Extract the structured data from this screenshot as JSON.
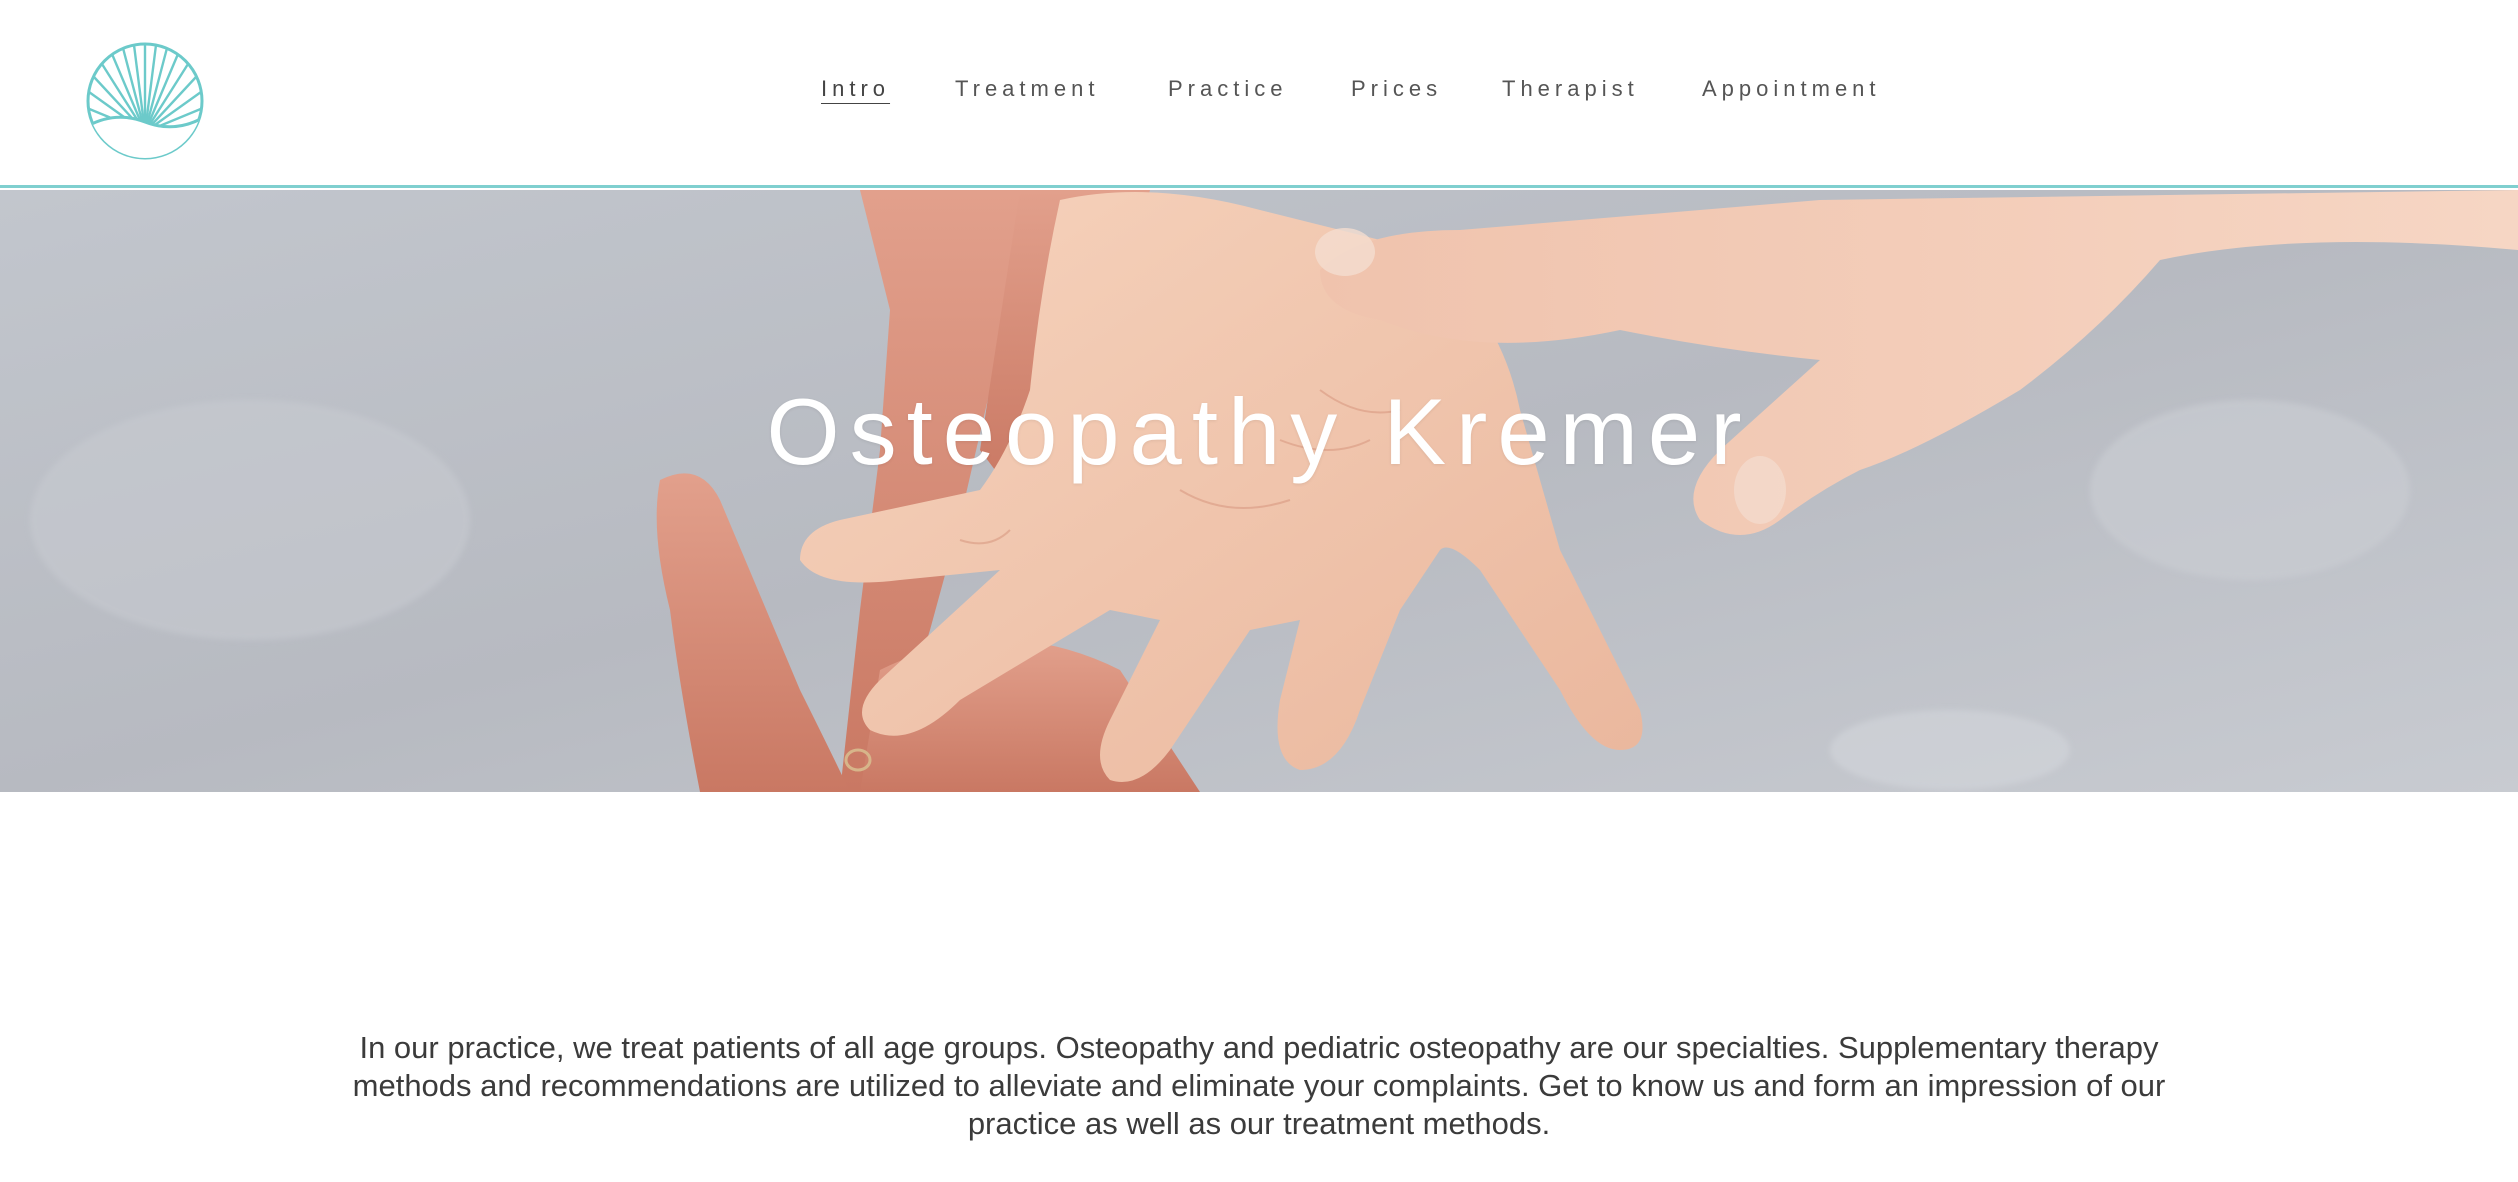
{
  "header": {
    "logo_icon": "sunrise-shell-logo-icon",
    "accent_color": "#7fcfcf",
    "nav": [
      {
        "label": "Intro",
        "active": true
      },
      {
        "label": "Treatment",
        "active": false
      },
      {
        "label": "Practice",
        "active": false
      },
      {
        "label": "Prices",
        "active": false
      },
      {
        "label": "Therapist",
        "active": false
      },
      {
        "label": "Appointment",
        "active": false
      }
    ]
  },
  "hero": {
    "title": "Osteopathy Kremer",
    "image_description_icon": "hands-photo"
  },
  "intro": {
    "text": "In our practice, we treat patients of all age groups. Osteopathy and pediatric osteopathy are our specialties. Supplementary therapy methods and recommendations are utilized to alleviate and eliminate your complaints. Get to know us and form an impression of our practice as well as our treatment methods."
  }
}
